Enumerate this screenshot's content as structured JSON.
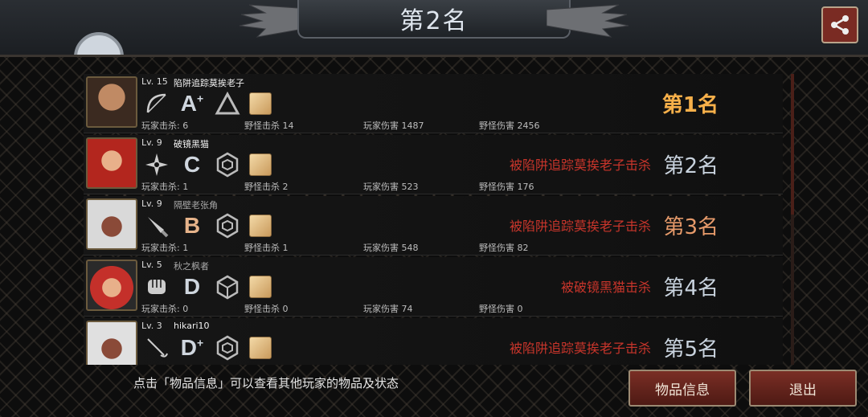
{
  "header": {
    "title": "第2名"
  },
  "players": [
    {
      "level": "Lv. 15",
      "name": "陷阱追踪莫挨老子",
      "name_style": "bright",
      "grade": "A",
      "grade_plus": "+",
      "player_kills": "玩家击杀: 6",
      "monster_kills": "野怪击杀 14",
      "player_damage": "玩家伤害 1487",
      "monster_damage": "野怪伤害 2456",
      "killed_by": "",
      "rank": "第1名",
      "rank_style": "gold",
      "portrait_color": "#6b4a33"
    },
    {
      "level": "Lv. 9",
      "name": "破镜黑猫",
      "name_style": "bright",
      "grade": "C",
      "grade_plus": "",
      "player_kills": "玩家击杀: 1",
      "monster_kills": "野怪击杀 2",
      "player_damage": "玩家伤害 523",
      "monster_damage": "野怪伤害 176",
      "killed_by": "被陷阱追踪莫挨老子击杀",
      "rank": "第2名",
      "rank_style": "silver",
      "portrait_color": "#b3261e"
    },
    {
      "level": "Lv. 9",
      "name": "隔壁老张角",
      "name_style": "dim",
      "grade": "B",
      "grade_plus": "",
      "player_kills": "玩家击杀: 1",
      "monster_kills": "野怪击杀 1",
      "player_damage": "玩家伤害 548",
      "monster_damage": "野怪伤害 82",
      "killed_by": "被陷阱追踪莫挨老子击杀",
      "rank": "第3名",
      "rank_style": "bronze",
      "portrait_color": "#d9d9d9"
    },
    {
      "level": "Lv. 5",
      "name": "秋之枫者",
      "name_style": "dim",
      "grade": "D",
      "grade_plus": "",
      "player_kills": "玩家击杀: 0",
      "monster_kills": "野怪击杀 0",
      "player_damage": "玩家伤害 74",
      "monster_damage": "野怪伤害 0",
      "killed_by": "被破镜黑猫击杀",
      "rank": "第4名",
      "rank_style": "silver",
      "portrait_color": "#c4302a"
    },
    {
      "level": "Lv. 3",
      "name": "hikari10",
      "name_style": "bright",
      "grade": "D",
      "grade_plus": "+",
      "player_kills": "",
      "monster_kills": "",
      "player_damage": "",
      "monster_damage": "",
      "killed_by": "被陷阱追踪莫挨老子击杀",
      "rank": "第5名",
      "rank_style": "silver",
      "portrait_color": "#e0e0e0"
    }
  ],
  "footer": {
    "hint": "点击「物品信息」可以查看其他玩家的物品及状态",
    "items_button": "物品信息",
    "exit_button": "退出"
  },
  "icons": {
    "share": "share-icon",
    "weapons": [
      "bow-icon",
      "shuriken-icon",
      "dagger-icon",
      "fist-icon",
      "rapier-icon"
    ],
    "class_marks": [
      "triangle-icon",
      "hexagon-icon",
      "hexagon-icon",
      "cube-icon",
      "hexagon-icon"
    ]
  },
  "colors": {
    "accent": "#7a2e25",
    "kill_text": "#c8352b",
    "gold_rank": "#f7b04a"
  }
}
